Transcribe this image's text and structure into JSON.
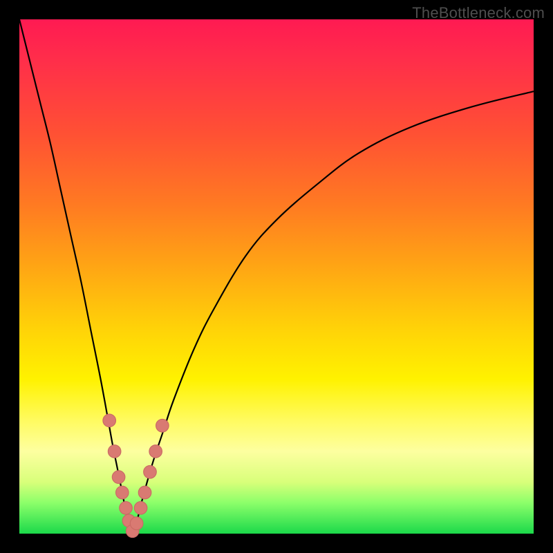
{
  "watermark": "TheBottleneck.com",
  "colors": {
    "frame": "#000000",
    "curve": "#000000",
    "marker_fill": "#d97a72",
    "marker_stroke": "#c96a63"
  },
  "chart_data": {
    "type": "line",
    "title": "",
    "xlabel": "",
    "ylabel": "",
    "xlim": [
      0,
      100
    ],
    "ylim": [
      0,
      100
    ],
    "note": "Axes are not labeled in the source image; units are plot percent (0–100). y = bottleneck %, minimum at x≈22.",
    "series": [
      {
        "name": "bottleneck-curve",
        "x": [
          0,
          2,
          4,
          6,
          8,
          10,
          12,
          14,
          16,
          18,
          19,
          20,
          21,
          22,
          23,
          24,
          26,
          28,
          30,
          34,
          38,
          44,
          50,
          58,
          66,
          76,
          88,
          100
        ],
        "y": [
          100,
          92,
          84,
          76,
          67,
          58,
          49,
          39,
          29,
          18,
          13,
          8,
          3,
          0,
          3,
          7,
          14,
          20,
          26,
          36,
          44,
          54,
          61,
          68,
          74,
          79,
          83,
          86
        ]
      }
    ],
    "markers": {
      "name": "highlighted-points",
      "x": [
        17.5,
        18.5,
        19.3,
        20.0,
        20.7,
        21.3,
        22.0,
        22.8,
        23.6,
        24.4,
        25.4,
        26.5,
        27.8
      ],
      "y": [
        22,
        16,
        11,
        8,
        5,
        2.5,
        0.5,
        2,
        5,
        8,
        12,
        16,
        21
      ]
    }
  }
}
